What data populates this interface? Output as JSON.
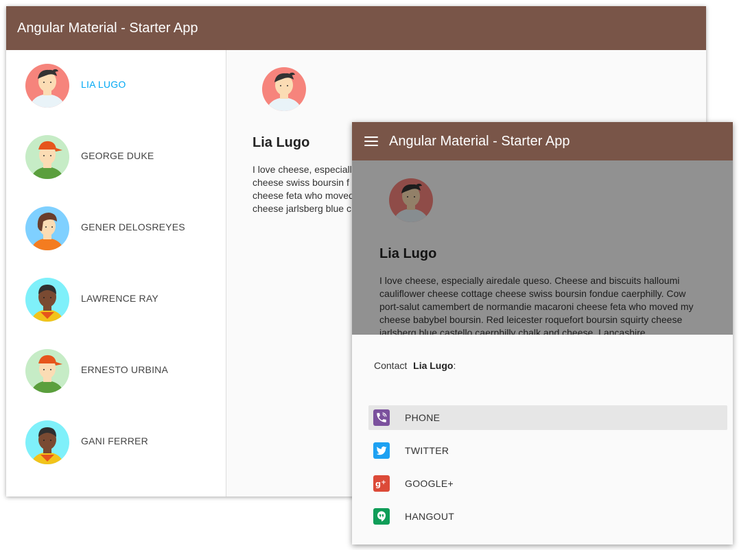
{
  "app": {
    "title": "Angular Material - Starter App",
    "toolbar_color": "#795548",
    "accent_color": "#03a9f4"
  },
  "sidenav": {
    "users": [
      {
        "name": "LIA LUGO",
        "selected": true,
        "avatar": "avatar-boy-black-hair"
      },
      {
        "name": "GEORGE DUKE",
        "selected": false,
        "avatar": "avatar-boy-red-cap"
      },
      {
        "name": "GENER DELOSREYES",
        "selected": false,
        "avatar": "avatar-girl-brown-hair"
      },
      {
        "name": "LAWRENCE RAY",
        "selected": false,
        "avatar": "avatar-dark-skin"
      },
      {
        "name": "ERNESTO URBINA",
        "selected": false,
        "avatar": "avatar-boy-red-cap"
      },
      {
        "name": "GANI FERRER",
        "selected": false,
        "avatar": "avatar-dark-skin"
      }
    ]
  },
  "detail": {
    "name": "Lia Lugo",
    "bio_back_lines": [
      "I love cheese, especiall",
      "cheese swiss boursin f",
      "cheese feta who moved",
      "cheese jarlsberg blue c"
    ],
    "bio_front_lines": [
      "I love cheese, especially airedale queso. Cheese and biscuits halloumi",
      "cauliflower cheese cottage cheese swiss boursin fondue caerphilly. Cow",
      "port-salut camembert de normandie macaroni cheese feta who moved my",
      "cheese babybel boursin. Red leicester roquefort boursin squirty cheese",
      "jarlsberg blue castello caerphilly chalk and cheese. Lancashire"
    ]
  },
  "bottom_sheet": {
    "contact_prefix": "Contact",
    "contact_name": "Lia Lugo",
    "contact_suffix": ":",
    "actions": [
      {
        "label": "PHONE",
        "icon": "phone-icon",
        "color": "#7b519d",
        "hover": true
      },
      {
        "label": "TWITTER",
        "icon": "twitter-icon",
        "color": "#1da1f2",
        "hover": false
      },
      {
        "label": "GOOGLE+",
        "icon": "google-plus-icon",
        "color": "#dc4a38",
        "hover": false
      },
      {
        "label": "HANGOUT",
        "icon": "hangout-icon",
        "color": "#0f9d58",
        "hover": false
      }
    ]
  }
}
